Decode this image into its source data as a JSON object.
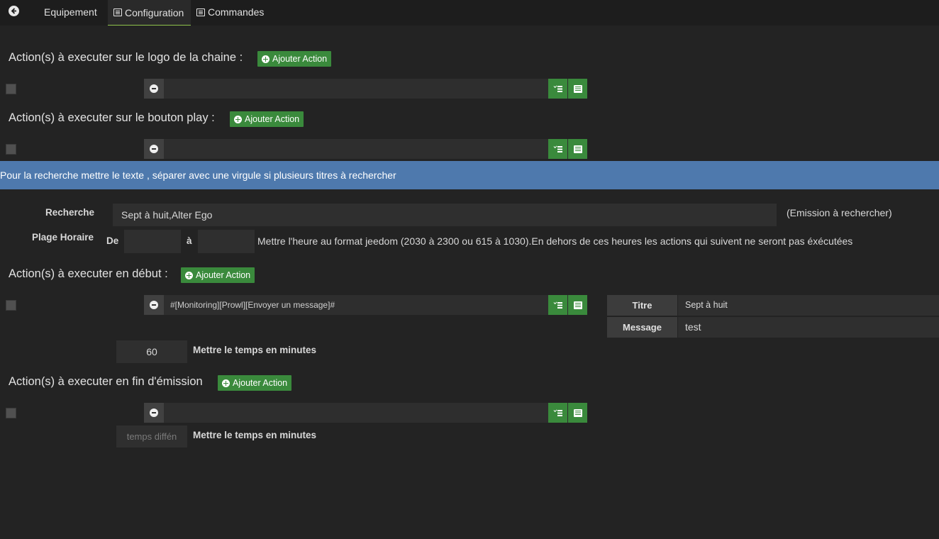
{
  "tabs": {
    "back_icon": "arrow-circle-left-icon",
    "equipement": "Equipement",
    "configuration": "Configuration",
    "commandes": "Commandes",
    "accent_color": "#8fc34b"
  },
  "add_action_label": "Ajouter Action",
  "sections": {
    "logo": {
      "title": "Action(s) à executer sur le logo de la chaine :",
      "command": ""
    },
    "play": {
      "title": "Action(s) à executer sur le bouton play :",
      "command": ""
    },
    "debut": {
      "title": "Action(s) à executer en début :",
      "command": "#[Monitoring][Prowl][Envoyer un message]#",
      "params": [
        {
          "label": "Titre",
          "value": "Sept à huit"
        },
        {
          "label": "Message",
          "value": "test"
        }
      ],
      "delay_value": "60",
      "delay_label": "Mettre le temps en minutes"
    },
    "fin": {
      "title": "Action(s) à executer en fin d'émission",
      "command": "",
      "delay_placeholder": "temps diffén",
      "delay_label": "Mettre le temps en minutes"
    }
  },
  "banner": "Pour la recherche mettre le texte , séparer avec une virgule si plusieurs titres à rechercher",
  "search": {
    "label": "Recherche",
    "value": "Sept à huit,Alter Ego",
    "hint": "(Emission à rechercher)"
  },
  "schedule": {
    "label": "Plage Horaire",
    "from_label": "De",
    "from_value": "",
    "to_label": "à",
    "to_value": "",
    "help": "Mettre l'heure au format jeedom (2030 à 2300 ou 615 à 1030).En dehors de ces heures les actions qui suivent ne seront pas éxécutées"
  },
  "colors": {
    "background": "#232323",
    "green": "#3a8a3c",
    "banner": "#4e79ad"
  }
}
